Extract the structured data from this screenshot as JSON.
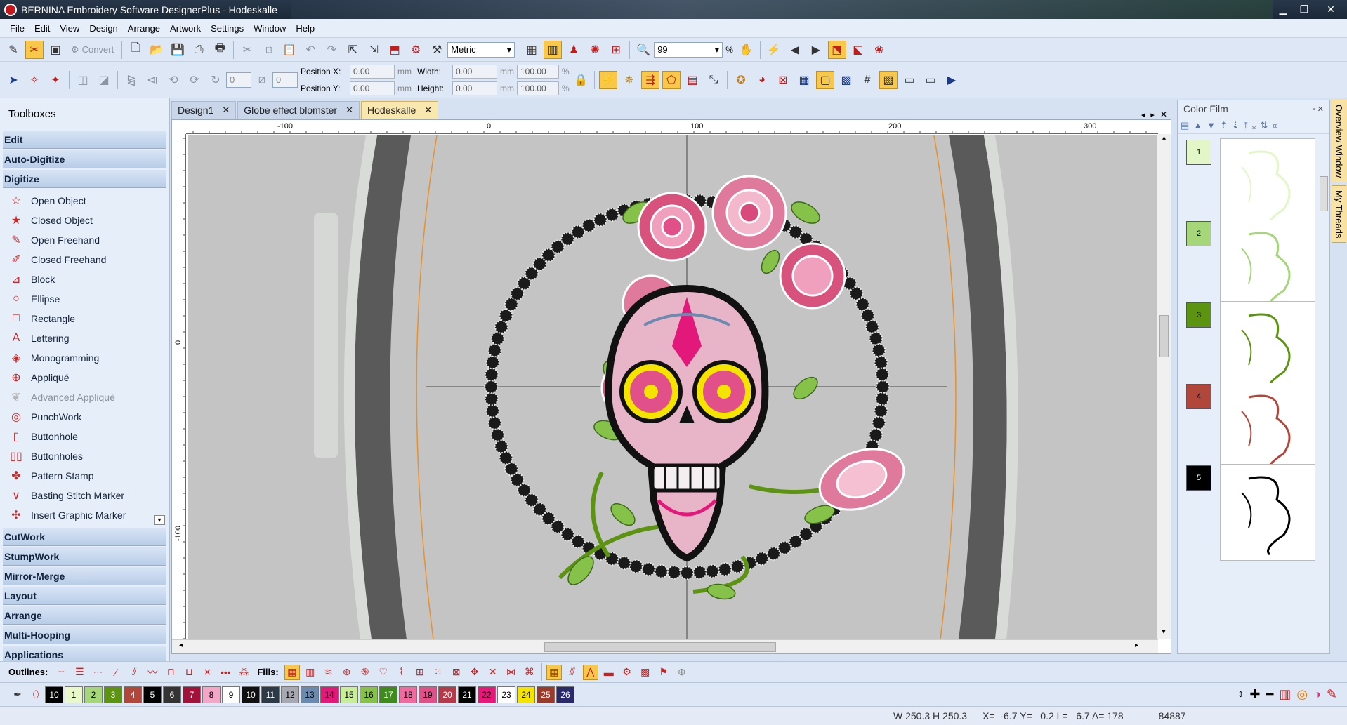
{
  "window": {
    "title": "BERNINA Embroidery Software DesignerPlus - Hodeskalle",
    "minimize": "▁",
    "restore": "❐",
    "close": "✕"
  },
  "menu": [
    "File",
    "Edit",
    "View",
    "Design",
    "Arrange",
    "Artwork",
    "Settings",
    "Window",
    "Help"
  ],
  "toolbar1": {
    "convert_label": "Convert",
    "units": "Metric",
    "zoom": "99",
    "zoom_unit": "%"
  },
  "toolbar2": {
    "rotate_value": "0",
    "slant_value": "0",
    "position_x_label": "Position X:",
    "position_x": "0.00",
    "position_y_label": "Position Y:",
    "position_y": "0.00",
    "width_label": "Width:",
    "width": "0.00",
    "height_label": "Height:",
    "height": "0.00",
    "scale_w": "100.00",
    "scale_h": "100.00",
    "unit": "mm",
    "pct": "%"
  },
  "toolboxes": {
    "title": "Toolboxes",
    "groups_top": [
      "Edit",
      "Auto-Digitize",
      "Digitize"
    ],
    "digitize_tools": [
      {
        "label": "Open Object",
        "icon": "open-object-icon",
        "glyph": "☆",
        "enabled": true
      },
      {
        "label": "Closed Object",
        "icon": "closed-object-icon",
        "glyph": "★",
        "enabled": true
      },
      {
        "label": "Open Freehand",
        "icon": "open-freehand-icon",
        "glyph": "✎",
        "enabled": true
      },
      {
        "label": "Closed Freehand",
        "icon": "closed-freehand-icon",
        "glyph": "✐",
        "enabled": true
      },
      {
        "label": "Block",
        "icon": "block-icon",
        "glyph": "⊿",
        "enabled": true
      },
      {
        "label": "Ellipse",
        "icon": "ellipse-icon",
        "glyph": "○",
        "enabled": true
      },
      {
        "label": "Rectangle",
        "icon": "rectangle-icon",
        "glyph": "□",
        "enabled": true
      },
      {
        "label": "Lettering",
        "icon": "lettering-icon",
        "glyph": "A",
        "enabled": true
      },
      {
        "label": "Monogramming",
        "icon": "monogramming-icon",
        "glyph": "◈",
        "enabled": true
      },
      {
        "label": "Appliqué",
        "icon": "applique-icon",
        "glyph": "⊕",
        "enabled": true
      },
      {
        "label": "Advanced Appliqué",
        "icon": "advanced-applique-icon",
        "glyph": "❦",
        "enabled": false
      },
      {
        "label": "PunchWork",
        "icon": "punchwork-icon",
        "glyph": "◎",
        "enabled": true
      },
      {
        "label": "Buttonhole",
        "icon": "buttonhole-icon",
        "glyph": "▯",
        "enabled": true
      },
      {
        "label": "Buttonholes",
        "icon": "buttonholes-icon",
        "glyph": "▯▯",
        "enabled": true
      },
      {
        "label": "Pattern Stamp",
        "icon": "pattern-stamp-icon",
        "glyph": "✤",
        "enabled": true
      },
      {
        "label": "Basting Stitch Marker",
        "icon": "basting-stitch-marker-icon",
        "glyph": "∨",
        "enabled": true
      },
      {
        "label": "Insert Graphic Marker",
        "icon": "insert-graphic-marker-icon",
        "glyph": "✣",
        "enabled": true
      }
    ],
    "groups_bottom": [
      "CutWork",
      "StumpWork",
      "Mirror-Merge",
      "Layout",
      "Arrange",
      "Multi-Hooping",
      "Applications"
    ]
  },
  "doc_tabs": [
    {
      "label": "Design1",
      "active": false
    },
    {
      "label": "Globe effect blomster",
      "active": false
    },
    {
      "label": "Hodeskalle",
      "active": true
    }
  ],
  "ruler": {
    "h_ticks": [
      "-100",
      "0",
      "100",
      "200",
      "300"
    ],
    "v_ticks": [
      "0",
      "-100"
    ]
  },
  "color_film": {
    "title": "Color Film",
    "items": [
      {
        "num": "1",
        "color": "#e3f6c8"
      },
      {
        "num": "2",
        "color": "#a6d67a"
      },
      {
        "num": "3",
        "color": "#5c9412"
      },
      {
        "num": "4",
        "color": "#b0473a"
      },
      {
        "num": "5",
        "color": "#000000"
      }
    ]
  },
  "side_tabs": [
    "Overview Window",
    "My Threads"
  ],
  "outlines": {
    "label": "Outlines:",
    "fills_label": "Fills:"
  },
  "palette": [
    {
      "n": "10",
      "c": "#000000"
    },
    {
      "n": "1",
      "c": "#e8f8c8"
    },
    {
      "n": "2",
      "c": "#a6d67a"
    },
    {
      "n": "3",
      "c": "#5c9412"
    },
    {
      "n": "4",
      "c": "#b0473a"
    },
    {
      "n": "5",
      "c": "#000000"
    },
    {
      "n": "6",
      "c": "#333333"
    },
    {
      "n": "7",
      "c": "#a0123a"
    },
    {
      "n": "8",
      "c": "#f4a6c6"
    },
    {
      "n": "9",
      "c": "#ffffff"
    },
    {
      "n": "10",
      "c": "#101010"
    },
    {
      "n": "11",
      "c": "#2c3a48"
    },
    {
      "n": "12",
      "c": "#a8a8b0"
    },
    {
      "n": "13",
      "c": "#6a8ab0"
    },
    {
      "n": "14",
      "c": "#e2187a"
    },
    {
      "n": "15",
      "c": "#c8ee9a"
    },
    {
      "n": "16",
      "c": "#86c24a"
    },
    {
      "n": "17",
      "c": "#3e8a1a"
    },
    {
      "n": "18",
      "c": "#f06aa0"
    },
    {
      "n": "19",
      "c": "#e2508a"
    },
    {
      "n": "20",
      "c": "#b43a4a"
    },
    {
      "n": "21",
      "c": "#000000"
    },
    {
      "n": "22",
      "c": "#e8187a"
    },
    {
      "n": "23",
      "c": "#ffffff"
    },
    {
      "n": "24",
      "c": "#f4e400"
    },
    {
      "n": "25",
      "c": "#9a3a2a"
    },
    {
      "n": "26",
      "c": "#2a2a6a"
    }
  ],
  "status": {
    "size": "W 250.3 H 250.3",
    "coords": "X=  -6.7 Y=   0.2 L=   6.7 A= 178",
    "stitches": "84887"
  },
  "colors": {
    "accent": "#f8c84a",
    "canvas": "#c4c4c4",
    "hoop": "#5a5a5a",
    "skull_pink": "#e2508a"
  }
}
